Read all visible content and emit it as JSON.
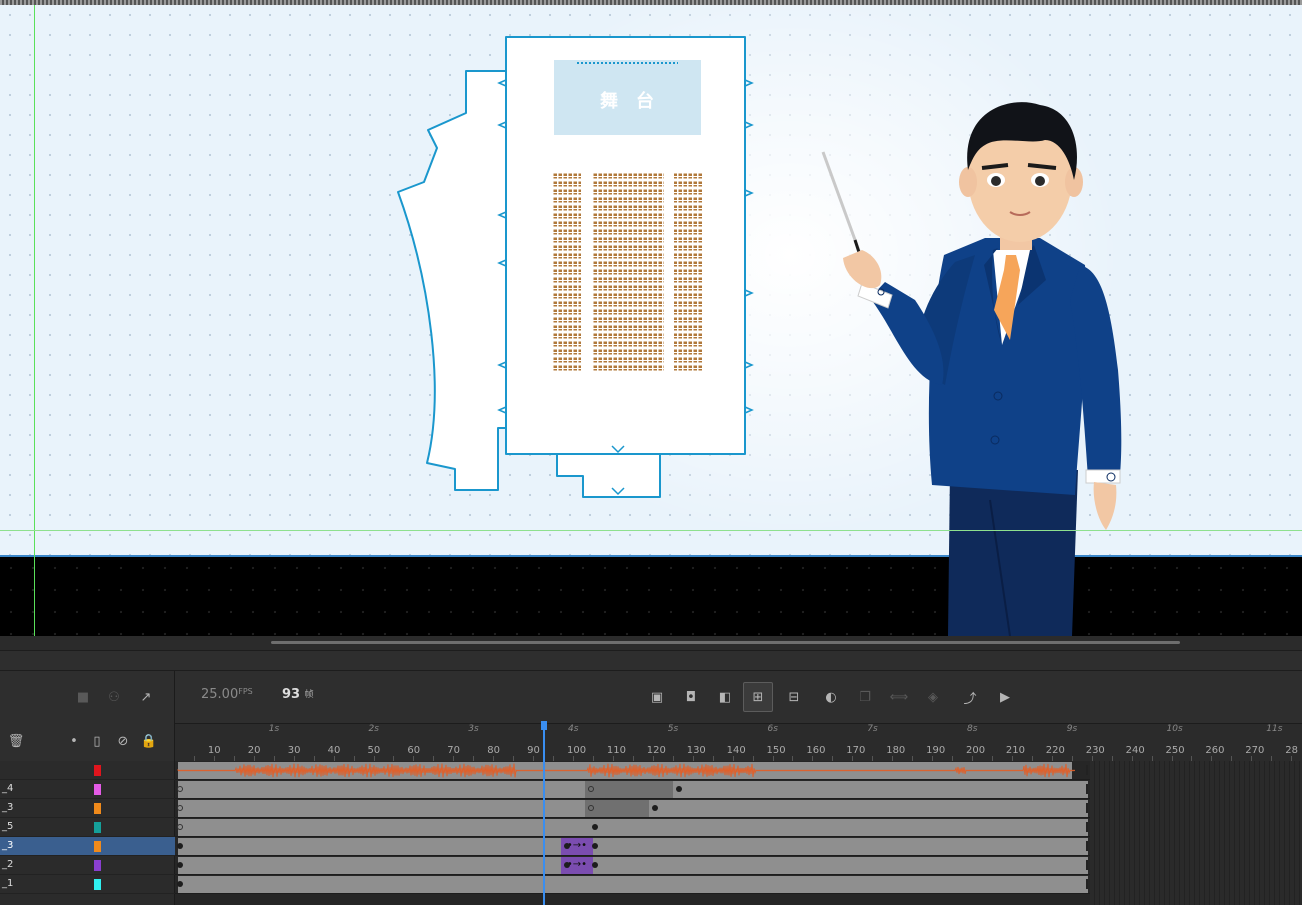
{
  "stage": {
    "stage_label": "舞　台",
    "background_color": "#e9f3fb",
    "grid_color": "#b7c8d8",
    "guide_color": "#5ae05a",
    "seat_color": "#b0783a",
    "venue_outline_color": "#1a97cd"
  },
  "toolbar": {
    "fps_value": "25.00",
    "fps_unit": "FPS",
    "current_frame": "93",
    "frame_unit": "帧",
    "icons": [
      "camera-icon",
      "layer-parenting-icon",
      "graph-icon",
      "insert-keyframe-icon",
      "insert-blank-keyframe-icon",
      "insert-frame-icon",
      "auto-keyframe-icon",
      "remove-frame-icon",
      "onion-skin-icon",
      "onion-skin-outline-icon",
      "edit-multiple-frames-icon",
      "onion-range-icon",
      "loop-icon",
      "play-icon"
    ]
  },
  "timeline": {
    "seconds": [
      "1s",
      "2s",
      "3s",
      "4s",
      "5s",
      "6s",
      "7s",
      "8s",
      "9s",
      "10s",
      "11s"
    ],
    "frame_numbers": [
      "10",
      "20",
      "30",
      "40",
      "50",
      "60",
      "70",
      "80",
      "90",
      "100",
      "110",
      "120",
      "130",
      "140",
      "150",
      "160",
      "170",
      "180",
      "190",
      "200",
      "210",
      "220",
      "230",
      "240",
      "250",
      "260",
      "270",
      "28"
    ],
    "playhead_frame": 93,
    "layers": [
      {
        "name": "",
        "color": "#e0151d",
        "selected": false
      },
      {
        "name": "_4",
        "color": "#e45be6",
        "selected": false
      },
      {
        "name": "_3",
        "color": "#f08a1b",
        "selected": false
      },
      {
        "name": "_5",
        "color": "#15a09a",
        "selected": false
      },
      {
        "name": "_3",
        "color": "#f08a1b",
        "selected": true
      },
      {
        "name": "_2",
        "color": "#8a3fd0",
        "selected": false
      },
      {
        "name": "_1",
        "color": "#30f0f0",
        "selected": false
      }
    ],
    "tween_arrow": "•→•"
  }
}
